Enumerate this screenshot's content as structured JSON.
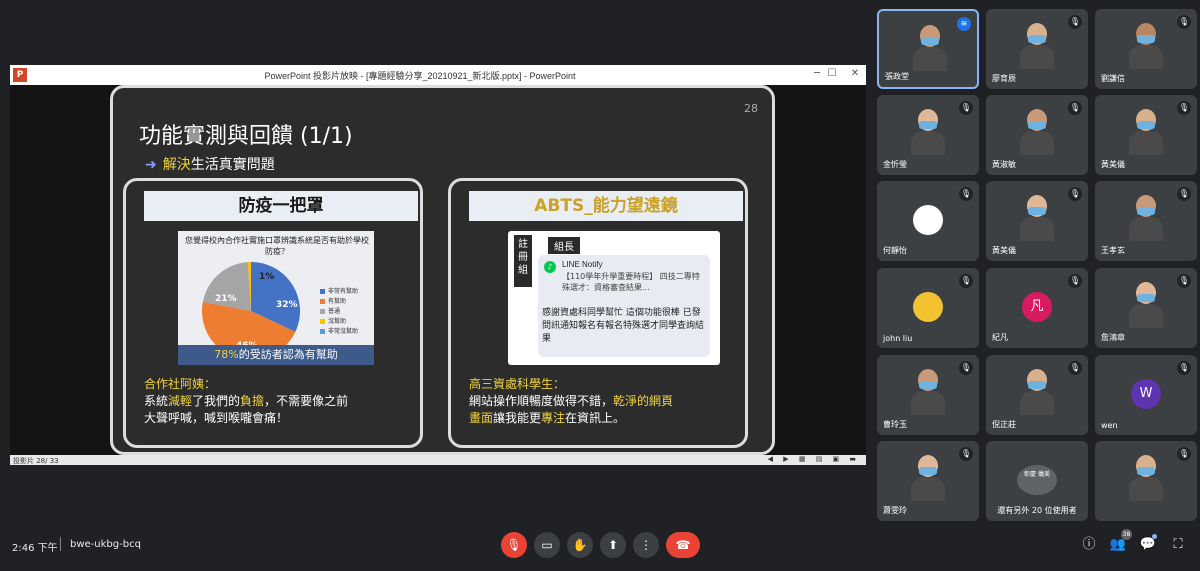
{
  "presentation": {
    "window_title": "PowerPoint 投影片放映 - [專題經驗分享_20210921_新北版.pptx] - PowerPoint",
    "status_left": "投影片 28/ 33",
    "slide": {
      "number": "28",
      "title": "功能實測與回饋 (1/1)",
      "subtitle_hl": "解決",
      "subtitle_rest": "生活真實問題",
      "left_panel": {
        "heading": "防疫一把罩",
        "chart_question": "您覺得校內合作社實施口罩辨識系統是否有助於學校防疫？",
        "chart_foot_hl": "78%",
        "chart_foot_rest": "的受訪者認為有幫助",
        "caption_who": "合作社阿姨：",
        "caption_line1_a": "系統",
        "caption_line1_hl": "減輕",
        "caption_line1_b": "了我們的",
        "caption_line1_hl2": "負擔",
        "caption_line1_c": "，不需要像之前",
        "caption_line2": "大聲呼喊，喊到喉嚨會痛！"
      },
      "right_panel": {
        "heading": "ABTS_能力望遠鏡",
        "col_label": "註冊組",
        "group": "組長",
        "line_name": "LINE Notify",
        "line_msg": "【110學年升學重要時程】 四技二專特殊選才：資格審查結果...",
        "thanks": "感謝資處科同學幫忙 這個功能很棒 已發問訊通知報名有報名特殊選才同學查詢結果",
        "caption_who": "高三資處科學生：",
        "caption_line1_a": "網站操作順暢度做得不錯，",
        "caption_line1_hl": "乾淨的網頁",
        "caption_line2_hl": "畫面",
        "caption_line2_a": "讓我能更",
        "caption_line2_hl2": "專注",
        "caption_line2_b": "在資訊上。"
      }
    }
  },
  "chart_data": {
    "type": "pie",
    "title": "您覺得校內合作社實施口罩辨識系統是否有助於學校防疫？",
    "categories": [
      "非常有幫助",
      "有幫助",
      "普通",
      "沒幫助",
      "非常沒幫助"
    ],
    "values": [
      32,
      46,
      21,
      1,
      0
    ],
    "labels": [
      "32%",
      "46%",
      "21%",
      "1%",
      ""
    ],
    "colors": [
      "#4472c4",
      "#ed7d31",
      "#a5a5a5",
      "#ffc000",
      "#5b9bd5"
    ],
    "legend": "right"
  },
  "participants": [
    {
      "name": "張政堂",
      "mic": "active",
      "speaking": true
    },
    {
      "name": "廖育辰",
      "mic": "muted"
    },
    {
      "name": "劉謙信",
      "mic": "muted"
    },
    {
      "name": "金忻瑩",
      "mic": "muted"
    },
    {
      "name": "黃淑敏",
      "mic": "muted"
    },
    {
      "name": "黃美儀",
      "mic": "muted"
    },
    {
      "name": "何靜怡",
      "mic": "muted",
      "avatar_bg": "#ffffff"
    },
    {
      "name": "黃美儀",
      "mic": "muted"
    },
    {
      "name": "王孝玄",
      "mic": "muted"
    },
    {
      "name": "john liu",
      "mic": "muted",
      "avatar_bg": "#f2c230"
    },
    {
      "name": "紀凡",
      "mic": "muted",
      "avatar": "凡",
      "avatar_bg": "#d81b60"
    },
    {
      "name": "詹鴻章",
      "mic": "muted"
    },
    {
      "name": "曹玲玉",
      "mic": "muted"
    },
    {
      "name": "倪正莊",
      "mic": "muted"
    },
    {
      "name": "wen",
      "mic": "muted",
      "avatar": "W",
      "avatar_bg": "#5e35b1"
    },
    {
      "name": "蕭雯玲",
      "mic": "muted"
    },
    {
      "name": "還有另外 20 位使用者",
      "mic": "none",
      "avatar": "彰慶 儀美"
    },
    {
      "name": "",
      "mic": "muted"
    }
  ],
  "bottombar": {
    "time": "2:46 下午",
    "meeting_code": "bwe-ukbg-bcq",
    "people_count": "38"
  }
}
